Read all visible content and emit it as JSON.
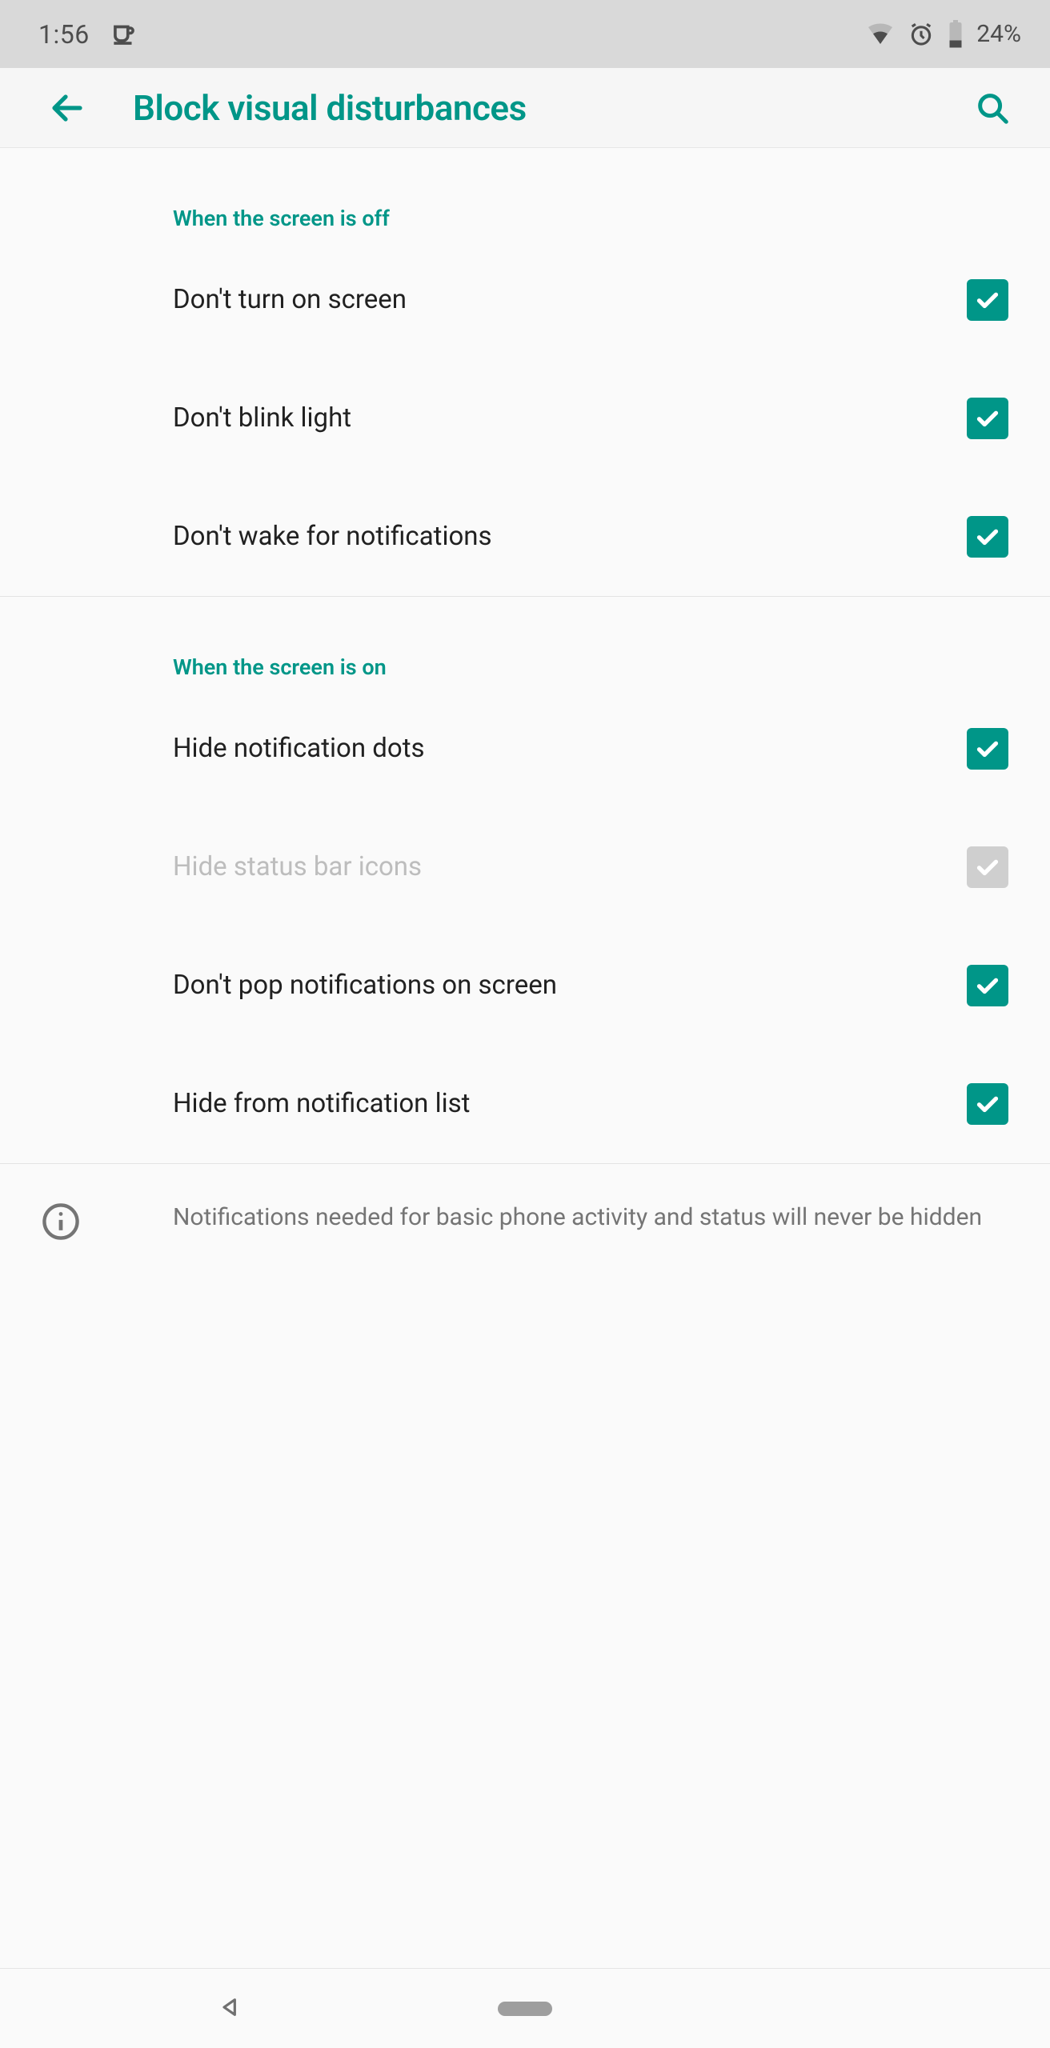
{
  "status": {
    "time": "1:56",
    "battery_text": "24%"
  },
  "appbar": {
    "title": "Block visual disturbances"
  },
  "sections": [
    {
      "header": "When the screen is off",
      "items": [
        {
          "key": "dont-turn-on-screen",
          "label": "Don't turn on screen",
          "checked": true,
          "disabled": false
        },
        {
          "key": "dont-blink-light",
          "label": "Don't blink light",
          "checked": true,
          "disabled": false
        },
        {
          "key": "dont-wake-notifications",
          "label": "Don't wake for notifications",
          "checked": true,
          "disabled": false
        }
      ]
    },
    {
      "header": "When the screen is on",
      "items": [
        {
          "key": "hide-notification-dots",
          "label": "Hide notification dots",
          "checked": true,
          "disabled": false
        },
        {
          "key": "hide-status-bar-icons",
          "label": "Hide status bar icons",
          "checked": true,
          "disabled": true
        },
        {
          "key": "dont-pop-notifications",
          "label": "Don't pop notifications on screen",
          "checked": true,
          "disabled": false
        },
        {
          "key": "hide-from-notification-list",
          "label": "Hide from notification list",
          "checked": true,
          "disabled": false
        }
      ]
    }
  ],
  "footer": {
    "info": "Notifications needed for basic phone activity and status will never be hidden"
  }
}
